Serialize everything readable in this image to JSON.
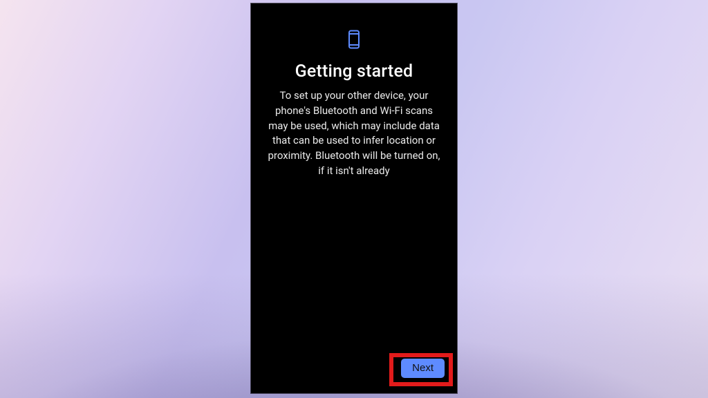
{
  "colors": {
    "accent": "#5e8bff",
    "highlight": "#e21b1b",
    "screen_bg": "#000000",
    "text": "#ffffff"
  },
  "icon": "phone-icon",
  "title": "Getting started",
  "body": "To set up your other device, your phone's Bluetooth and Wi-Fi scans may be used, which may include data that can be used to infer location or proximity. Bluetooth will be turned on, if it isn't already",
  "actions": {
    "next_label": "Next"
  }
}
